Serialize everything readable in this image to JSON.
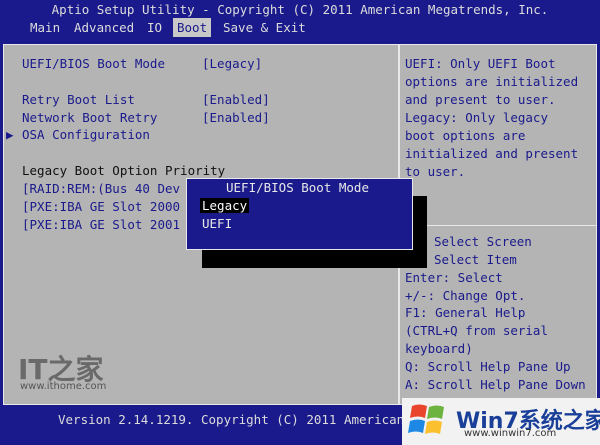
{
  "title": "Aptio Setup Utility - Copyright (C) 2011 American Megatrends, Inc.",
  "menu": [
    "Main",
    "Advanced",
    "IO",
    "Boot",
    "Save & Exit"
  ],
  "settings": {
    "boot_mode_label": "UEFI/BIOS Boot Mode",
    "boot_mode_value": "[Legacy]",
    "retry_label": "Retry Boot List",
    "retry_value": "[Enabled]",
    "netboot_label": "Network Boot Retry",
    "netboot_value": "[Enabled]",
    "osa_arrow": "▶",
    "osa_label": "OSA Configuration",
    "priority_heading": "Legacy Boot Option Priority",
    "boot_options": [
      "[RAID:REM:(Bus 40 Dev",
      "[PXE:IBA GE Slot 2000",
      "[PXE:IBA GE Slot 2001"
    ]
  },
  "help_text": [
    "UEFI: Only UEFI Boot",
    "options are initialized",
    "and present to user.",
    "Legacy: Only legacy",
    "boot options are",
    "initialized and present",
    "to user."
  ],
  "key_help": [
    "Select Screen",
    "Select Item",
    "Enter: Select",
    "+/-: Change Opt.",
    "F1: General Help",
    "(CTRL+Q from serial",
    "keyboard)",
    "Q: Scroll Help Pane Up",
    "A: Scroll Help Pane Down"
  ],
  "popup": {
    "title": "UEFI/BIOS Boot Mode",
    "options": [
      "Legacy",
      "UEFI"
    ],
    "selected": "Legacy"
  },
  "footer": "Version 2.14.1219. Copyright (C) 2011 American",
  "watermarks": {
    "ithome_logo": "IT之家",
    "ithome_url": "www.ithome.com",
    "win7_text": "Win7系统之家",
    "win7_sub": "www.winwin7.com"
  },
  "colors": {
    "bios_blue": "#1a1a8c",
    "panel_gray": "#b4b4b4",
    "highlight": "#000000"
  }
}
